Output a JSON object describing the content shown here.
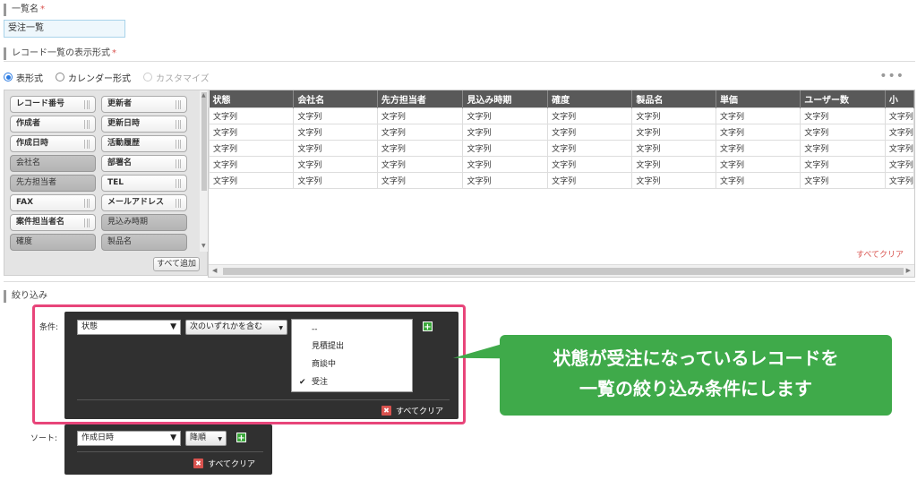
{
  "list_name": {
    "label": "一覧名",
    "required_mark": "*",
    "value": "受注一覧"
  },
  "display_format": {
    "label": "レコード一覧の表示形式",
    "required_mark": "*",
    "options": [
      {
        "label": "表形式",
        "selected": true,
        "disabled": false
      },
      {
        "label": "カレンダー形式",
        "selected": false,
        "disabled": false
      },
      {
        "label": "カスタマイズ",
        "selected": false,
        "disabled": true
      }
    ],
    "more_icon": "•••"
  },
  "field_palette": {
    "fields": [
      {
        "label": "レコード番号",
        "in_use": false
      },
      {
        "label": "更新者",
        "in_use": false
      },
      {
        "label": "作成者",
        "in_use": false
      },
      {
        "label": "更新日時",
        "in_use": false
      },
      {
        "label": "作成日時",
        "in_use": false
      },
      {
        "label": "活動履歴",
        "in_use": false
      },
      {
        "label": "会社名",
        "in_use": true
      },
      {
        "label": "部署名",
        "in_use": false
      },
      {
        "label": "先方担当者",
        "in_use": true
      },
      {
        "label": "TEL",
        "in_use": false
      },
      {
        "label": "FAX",
        "in_use": false
      },
      {
        "label": "メールアドレス",
        "in_use": false
      },
      {
        "label": "案件担当者名",
        "in_use": false
      },
      {
        "label": "見込み時期",
        "in_use": true
      },
      {
        "label": "確度",
        "in_use": true
      },
      {
        "label": "製品名",
        "in_use": true
      }
    ],
    "add_all_label": "すべて追加"
  },
  "preview_table": {
    "columns": [
      "状態",
      "会社名",
      "先方担当者",
      "見込み時期",
      "確度",
      "製品名",
      "単価",
      "ユーザー数",
      "小"
    ],
    "cell_text": "文字列",
    "row_count": 5,
    "clear_all_label": "すべてクリア"
  },
  "filter": {
    "section_label": "絞り込み",
    "condition_label": "条件:",
    "field_select": "状態",
    "operator_select": "次のいずれかを含む",
    "options": [
      {
        "label": "--",
        "checked": false
      },
      {
        "label": "見積提出",
        "checked": false
      },
      {
        "label": "商談中",
        "checked": false
      },
      {
        "label": "受注",
        "checked": true
      }
    ],
    "check_mark": "✔",
    "add_icon": "+",
    "clear_all_label": "すべてクリア",
    "clear_icon": "✖"
  },
  "sort": {
    "label": "ソート:",
    "field_select": "作成日時",
    "order_select": "降順",
    "add_icon": "+",
    "clear_all_label": "すべてクリア",
    "clear_icon": "✖"
  },
  "callout": {
    "line1": "状態が受注になっているレコードを",
    "line2": "一覧の絞り込み条件にします"
  },
  "colors": {
    "accent_blue": "#2a7ae2",
    "header_dark": "#595959",
    "panel_dark": "#303030",
    "highlight_pink": "#e8457a",
    "callout_green": "#3faa4a",
    "clear_red": "#d9534f"
  }
}
